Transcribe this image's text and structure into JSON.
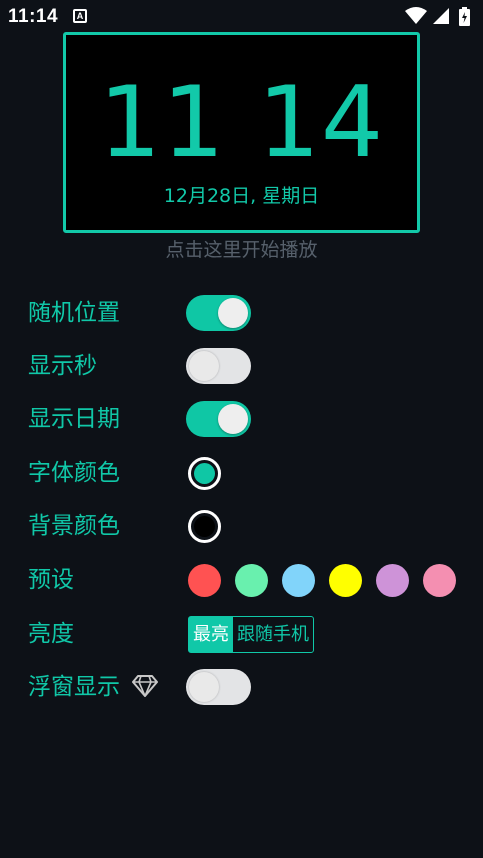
{
  "status_bar": {
    "time": "11:14",
    "notification_icon": "A",
    "icons": [
      "wifi-icon",
      "signal-icon",
      "battery-charging-icon"
    ]
  },
  "clock": {
    "time": "11 14",
    "date": "12月28日, 星期日"
  },
  "hint": "点击这里开始播放",
  "settings": {
    "random_position": {
      "label": "随机位置",
      "enabled": true
    },
    "show_seconds": {
      "label": "显示秒",
      "enabled": false
    },
    "show_date": {
      "label": "显示日期",
      "enabled": true
    },
    "font_color": {
      "label": "字体颜色",
      "color": "#0fc7a5"
    },
    "bg_color": {
      "label": "背景颜色",
      "color": "#000000"
    },
    "presets": {
      "label": "预设",
      "colors": [
        "#ff5252",
        "#69f0ae",
        "#81d4fa",
        "#ffff00",
        "#ce93d8",
        "#f48fb1"
      ]
    },
    "brightness": {
      "label": "亮度",
      "options": [
        "最亮",
        "跟随手机"
      ],
      "selected": "最亮"
    },
    "floating_window": {
      "label": "浮窗显示",
      "enabled": false,
      "icon": "diamond-icon"
    }
  },
  "colors": {
    "accent": "#10c8a8",
    "background": "#0d1117",
    "hint": "#56606b"
  }
}
